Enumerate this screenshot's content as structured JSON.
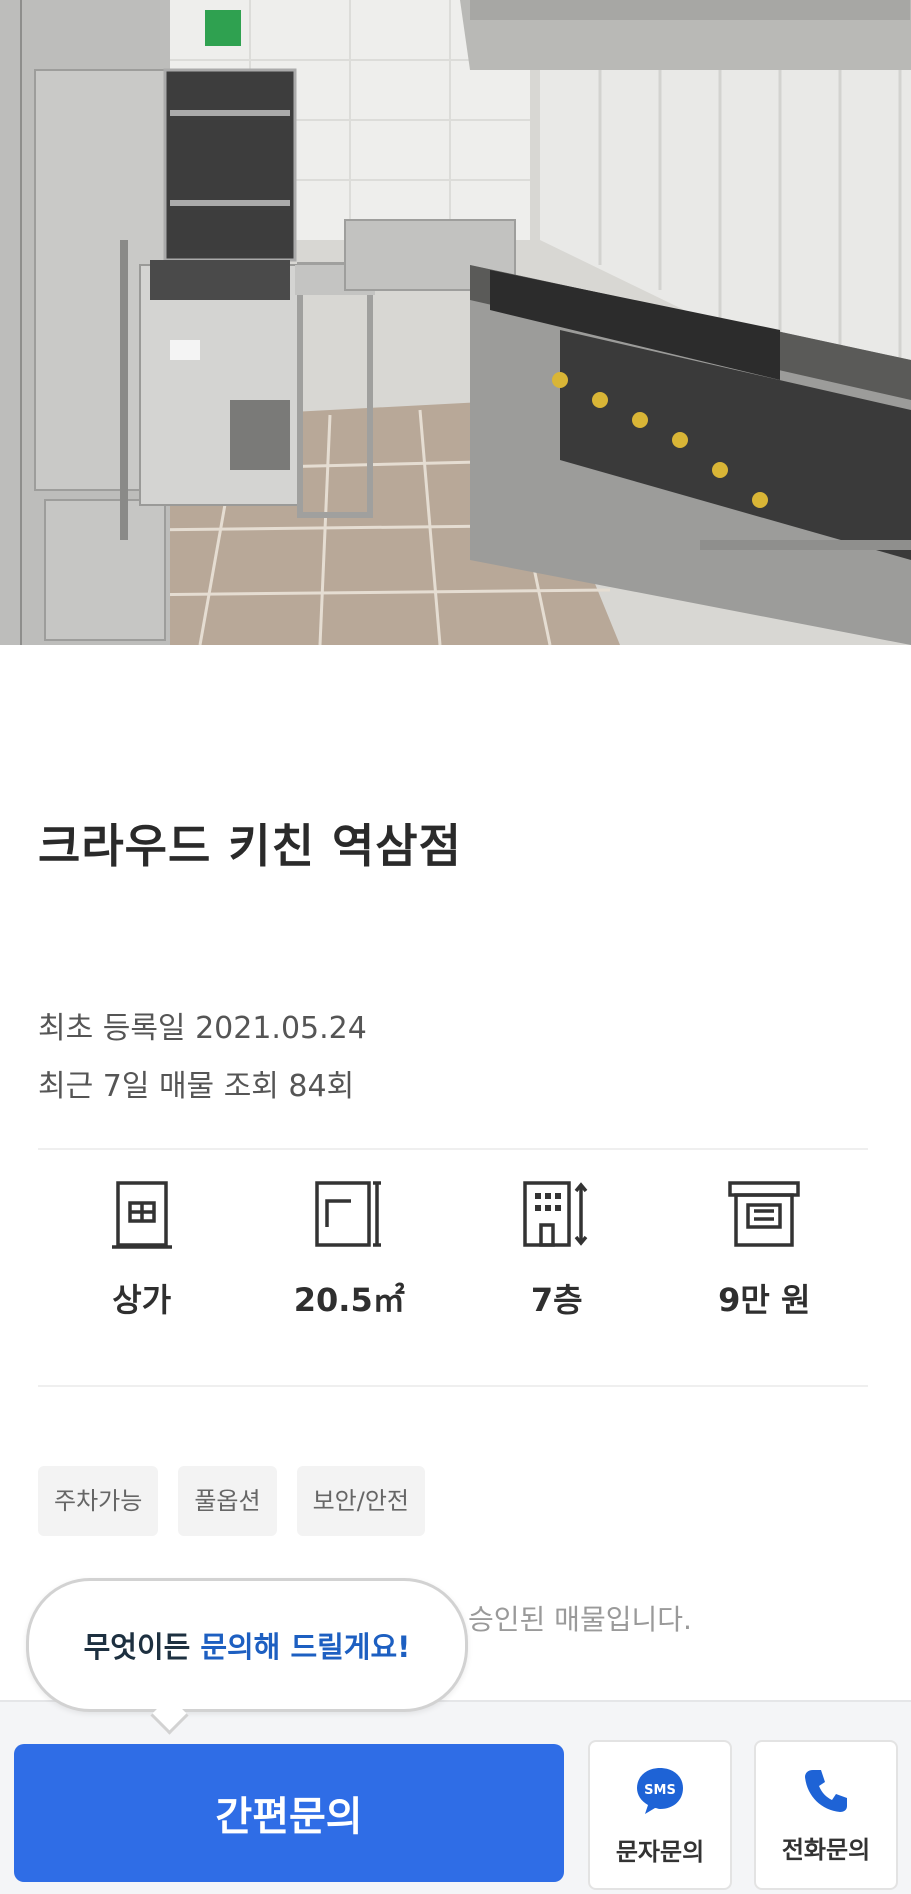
{
  "listing": {
    "title": "크라우드 키친 역삼점",
    "first_registered": "최초 등록일 2021.05.24",
    "recent_views": "최근 7일 매물 조회 84회"
  },
  "specs": [
    {
      "icon": "store-icon",
      "value": "상가"
    },
    {
      "icon": "floor-area-icon",
      "value": "20.5㎡"
    },
    {
      "icon": "building-floor-icon",
      "value": "7층"
    },
    {
      "icon": "maintenance-fee-icon",
      "value": "9만 원"
    }
  ],
  "tags": [
    "주차가능",
    "풀옵션",
    "보안/안전"
  ],
  "description_visible": "승인된 매물입니다.",
  "bubble": {
    "prefix": "무엇이든",
    "highlight": "문의해 드릴게요!"
  },
  "bottom_bar": {
    "quick_inquiry": "간편문의",
    "sms_badge": "SMS",
    "sms_label": "문자문의",
    "call_label": "전화문의"
  },
  "colors": {
    "primary": "#2f6de6",
    "highlight": "#1d5fc1",
    "tag_bg": "#f3f3f3"
  }
}
